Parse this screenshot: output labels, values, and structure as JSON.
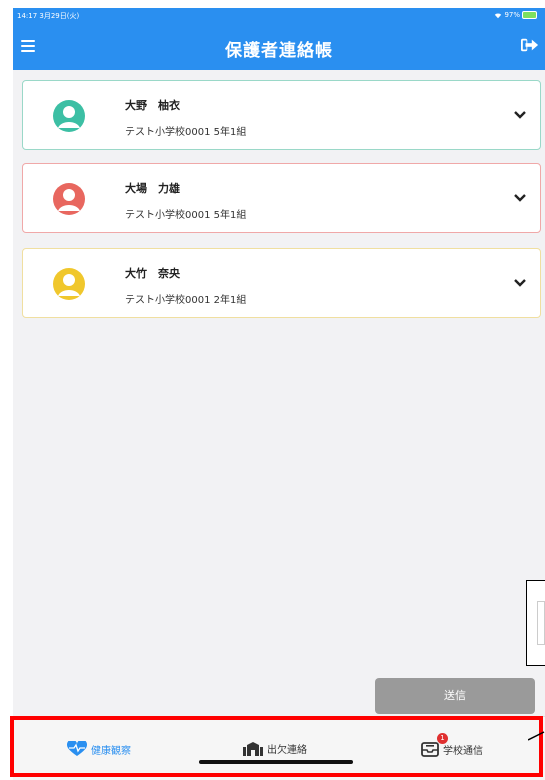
{
  "status_bar": {
    "time": "14:17  3月29日(火)",
    "battery": "97%"
  },
  "header": {
    "title": "保護者連絡帳"
  },
  "children": [
    {
      "name": "大野　柚衣",
      "school": "テスト小学校0001 5年1組",
      "color": "#3cbfa4",
      "border": "#9ad8c8"
    },
    {
      "name": "大場　力雄",
      "school": "テスト小学校0001 5年1組",
      "color": "#e8675f",
      "border": "#f0a8a8"
    },
    {
      "name": "大竹　奈央",
      "school": "テスト小学校0001 2年1組",
      "color": "#f0c72c",
      "border": "#f0dfa0"
    }
  ],
  "send_button": "送信",
  "tabs": [
    {
      "label": "健康観察",
      "icon": "heart-pulse-icon"
    },
    {
      "label": "出欠連絡",
      "icon": "school-building-icon"
    },
    {
      "label": "学校通信",
      "icon": "mail-tray-icon",
      "badge": "1"
    }
  ],
  "colors": {
    "accent": "#2a8ff0",
    "highlight": "#ff0000"
  }
}
